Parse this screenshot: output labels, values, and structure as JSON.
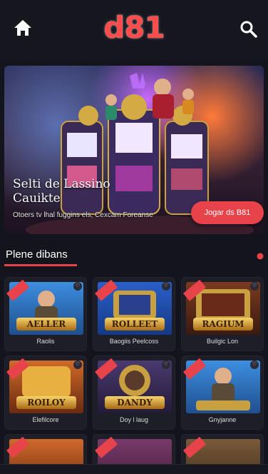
{
  "header": {
    "logo": "d81",
    "home_icon": "home-icon",
    "search_icon": "search-icon"
  },
  "hero": {
    "title_line1": "Selti de Lassino",
    "title_line2": "Cauikte",
    "subtitle": "Otoers tv lhal fuggins els, Cexcam Foreanse",
    "cta": "Jogar ds B81"
  },
  "section": {
    "heading": "Plene dibans"
  },
  "games": [
    {
      "name": "Raolis",
      "plate": "AELLER",
      "theme": "#2f7fd0"
    },
    {
      "name": "Baogiis Peelcoss",
      "plate": "ROLLEET",
      "theme": "#1c4aa8"
    },
    {
      "name": "Builgic Lon",
      "plate": "RAGIUM",
      "theme": "#6a2a1a"
    },
    {
      "name": "Elefilcore",
      "plate": "ROILOY",
      "theme": "#b8461a"
    },
    {
      "name": "Doy l laug",
      "plate": "DANDY",
      "theme": "#3d2a5a"
    },
    {
      "name": "Gnyjanne",
      "plate": "",
      "theme": "#2f7fd0"
    }
  ],
  "colors": {
    "accent": "#e8424a",
    "background": "#14151c"
  }
}
